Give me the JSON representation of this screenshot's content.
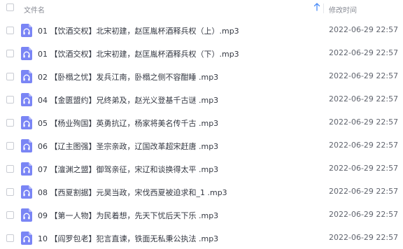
{
  "header": {
    "name_label": "文件名",
    "time_label": "修改时间",
    "sort_icon": "sort-up-arrow-icon"
  },
  "colors": {
    "icon_accent": "#7a85f5",
    "sort_arrow": "#4a8cf7"
  },
  "files": [
    {
      "name": "01 【饮酒交权】北宋初建，赵匡胤杯酒释兵权（上）.mp3",
      "modified": "2022-06-29 22:57",
      "icon": "audio-file-icon"
    },
    {
      "name": "01 【饮酒交权】北宋初建，赵匡胤杯酒释兵权（下）.mp3",
      "modified": "2022-06-29 22:57",
      "icon": "audio-file-icon"
    },
    {
      "name": "02 【卧榻之忧】发兵江南，卧榻之侧不容酣睡 .mp3",
      "modified": "2022-06-29 22:57",
      "icon": "audio-file-icon"
    },
    {
      "name": "04 【金匮盟约】兄终弟及，赵光义登基千古谜 .mp3",
      "modified": "2022-06-29 22:57",
      "icon": "audio-file-icon"
    },
    {
      "name": "05 【杨业殉国】英勇抗辽，杨家将美名传千古 .mp3",
      "modified": "2022-06-29 22:57",
      "icon": "audio-file-icon"
    },
    {
      "name": "06 【辽主图强】圣宗亲政，辽国改革超宋赶唐 .mp3",
      "modified": "2022-06-29 22:57",
      "icon": "audio-file-icon"
    },
    {
      "name": "07 【澶渊之盟】御驾亲征，宋辽和谈换得太平 .mp3",
      "modified": "2022-06-29 22:57",
      "icon": "audio-file-icon"
    },
    {
      "name": "08 【西夏割据】元昊当政，宋伐西夏被迫求和_1 .mp3",
      "modified": "2022-06-29 22:57",
      "icon": "audio-file-icon"
    },
    {
      "name": "09 【第一人物】为民着想，先天下忧后天下乐 .mp3",
      "modified": "2022-06-29 22:57",
      "icon": "audio-file-icon"
    },
    {
      "name": "10 【阎罗包老】犯言直谏，铁面无私秉公执法 .mp3",
      "modified": "2022-06-29 22:57",
      "icon": "audio-file-icon"
    }
  ]
}
